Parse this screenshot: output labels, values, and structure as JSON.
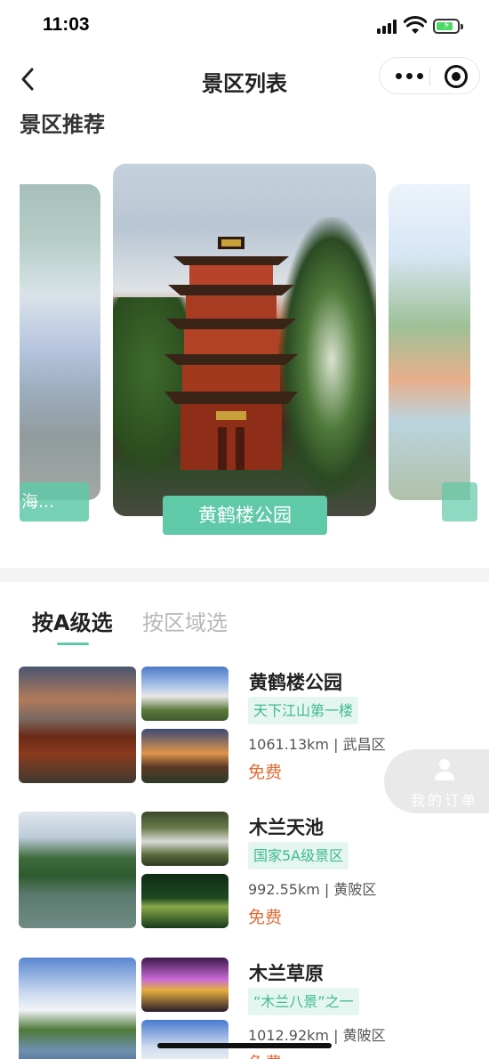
{
  "status_bar": {
    "time": "11:03"
  },
  "nav": {
    "title": "景区列表"
  },
  "recommend": {
    "title": "景区推荐",
    "cards": [
      {
        "label": "海..."
      },
      {
        "label": "黄鹤楼公园"
      },
      {
        "label": ""
      }
    ]
  },
  "tabs": [
    {
      "label": "按A级选"
    },
    {
      "label": "按区域选"
    }
  ],
  "spots": [
    {
      "name": "黄鹤楼公园",
      "tag": "天下江山第一楼",
      "meta": "1061.13km | 武昌区",
      "price": "免费"
    },
    {
      "name": "木兰天池",
      "tag": "国家5A级景区",
      "meta": "992.55km | 黄陂区",
      "price": "免费"
    },
    {
      "name": "木兰草原",
      "tag": "“木兰八景”之一",
      "meta": "1012.92km | 黄陂区",
      "price": "免费"
    }
  ],
  "order": {
    "label": "我的订单"
  },
  "colors": {
    "accent": "#5fc9a8",
    "price": "#e06c36",
    "tag_text": "#3fba8f"
  }
}
